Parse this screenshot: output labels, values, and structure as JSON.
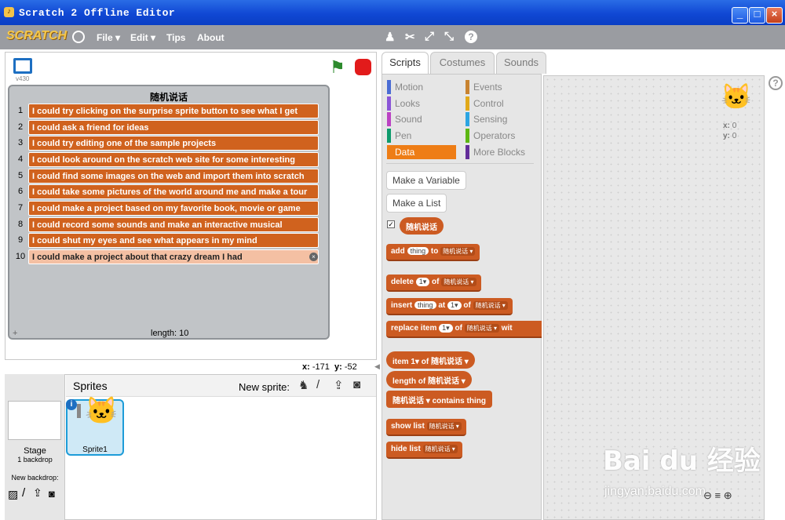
{
  "window": {
    "title": "Scratch 2 Offline Editor"
  },
  "menu": {
    "logo": "SCRATCH",
    "file": "File ▾",
    "edit": "Edit ▾",
    "tips": "Tips",
    "about": "About"
  },
  "stage": {
    "version": "v430",
    "list": {
      "title": "随机说话",
      "items": [
        "I could try clicking on the surprise sprite button to see what I get",
        "I could ask a friend for ideas",
        "I could try editing one of the sample projects",
        "I could look around on the scratch web site for some interesting",
        "I could find some images on the web and import them into scratch",
        "I could take some pictures of the world around me and make a tour",
        "I could make a project based on my favorite book, movie or game",
        "I could record some sounds and make an interactive musical",
        "I could shut my eyes and see what appears in my mind",
        "I could make a project about that crazy dream I had"
      ],
      "length_label": "length: 10"
    },
    "x_label": "x:",
    "x_value": "-171",
    "y_label": "y:",
    "y_value": "-52"
  },
  "sprites": {
    "header": "Sprites",
    "new_sprite": "New sprite:",
    "stage_label": "Stage",
    "backdrops": "1 backdrop",
    "new_backdrop": "New backdrop:",
    "sprite1": "Sprite1"
  },
  "tabs": {
    "scripts": "Scripts",
    "costumes": "Costumes",
    "sounds": "Sounds"
  },
  "categories": {
    "motion": "Motion",
    "looks": "Looks",
    "sound": "Sound",
    "pen": "Pen",
    "data": "Data",
    "events": "Events",
    "control": "Control",
    "sensing": "Sensing",
    "operators": "Operators",
    "more": "More Blocks"
  },
  "palette": {
    "make_variable": "Make a Variable",
    "make_list": "Make a List",
    "list_reporter": "随机说话",
    "blocks": {
      "add": "add",
      "thing": "thing",
      "to": "to",
      "listname": "随机说话",
      "delete": "delete",
      "of": "of",
      "one": "1",
      "insert": "insert",
      "at": "at",
      "replace": "replace item",
      "with": "wit",
      "item": "item",
      "length": "length of",
      "contains": "contains",
      "show": "show list",
      "hide": "hide list"
    }
  },
  "scriptarea": {
    "x_label": "x:",
    "x_value": "0",
    "y_label": "y:",
    "y_value": "0"
  },
  "watermark": {
    "main": "Bai du 经验",
    "sub": "jingyan.baidu.com"
  },
  "colors": {
    "titlebar": "#1048d4",
    "menubar": "#9a9ca1",
    "data": "#ee7d16",
    "list_block": "#cc5b22"
  }
}
